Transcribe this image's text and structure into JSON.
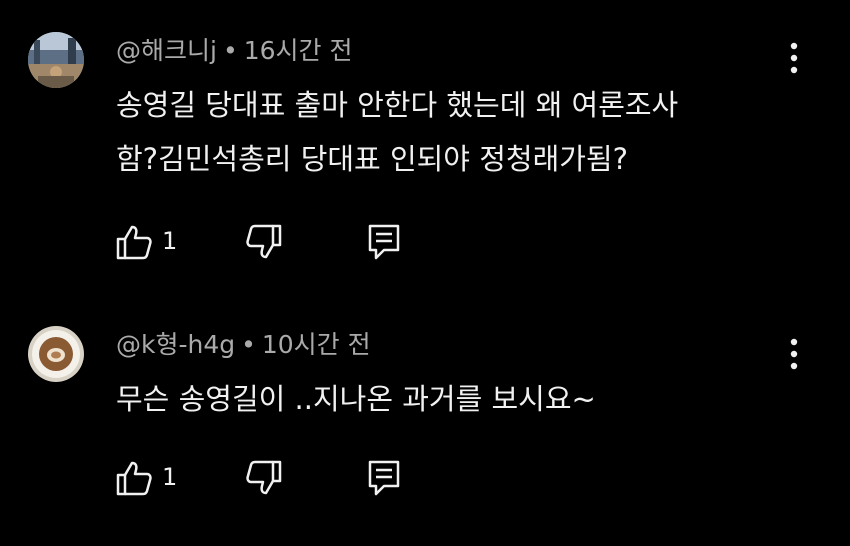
{
  "comments": [
    {
      "author": "@해크니j",
      "time": "16시간 전",
      "lines": [
        "송영길 당대표 출마 안한다 했는데 왜 여론조사",
        "함?김민석총리 당대표 인되야  정청래가됨?"
      ],
      "likes": "1",
      "avatar_icon": "landscape-avatar-icon"
    },
    {
      "author": "@k형-h4g",
      "time": "10시간 전",
      "lines": [
        "무슨 송영길이 ..지나온 과거를 보시요~"
      ],
      "likes": "1",
      "avatar_icon": "latte-art-avatar-icon"
    }
  ],
  "meta_separator": "•",
  "icons": {
    "like": "thumb-up-icon",
    "dislike": "thumb-down-icon",
    "reply": "reply-icon",
    "more": "more-vert-icon"
  },
  "colors": {
    "background": "#000000",
    "text": "#f1f1f1",
    "meta": "#aaaaaa"
  }
}
